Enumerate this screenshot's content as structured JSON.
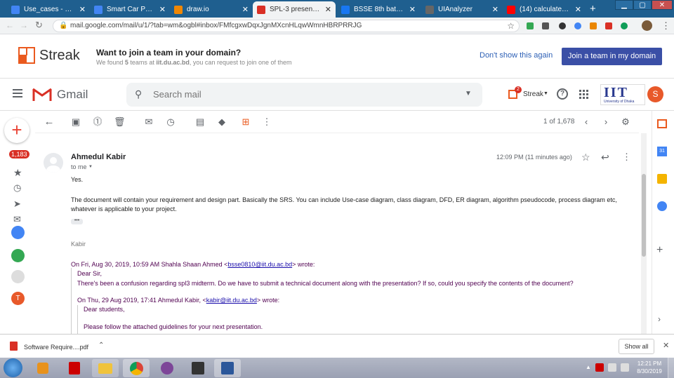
{
  "browser": {
    "tabs": [
      {
        "title": "Use_cases - Google",
        "color": "#4285f4"
      },
      {
        "title": "Smart Car Parking /",
        "color": "#4285f4"
      },
      {
        "title": "draw.io",
        "color": "#f08705"
      },
      {
        "title": "SPL-3 presentation",
        "color": "#d93025"
      },
      {
        "title": "BSSE 8th batch, IIT",
        "color": "#1877f2"
      },
      {
        "title": "UIAnalyzer",
        "color": "#333333"
      },
      {
        "title": "(14) calculate dista",
        "color": "#ff0000"
      }
    ],
    "new_tab": "+",
    "url": "mail.google.com/mail/u/1/?tab=wm&ogbl#inbox/FMfcgxwDqxJgnMXcnHLqwWmnHBRPRRJG"
  },
  "streak": {
    "brand": "Streak",
    "headline": "Want to join a team in your domain?",
    "sub_a": "We found ",
    "sub_count": "5",
    "sub_b": " teams at ",
    "sub_domain": "iit.du.ac.bd",
    "sub_c": ", you can request to join one of them",
    "dismiss": "Don't show this again",
    "join": "Join a team in my domain"
  },
  "gmail": {
    "logo": "Gmail",
    "search_placeholder": "Search mail",
    "streak_label": "Streak",
    "streak_badge": "2",
    "account_initial": "S",
    "org_logo": "IIT",
    "org_sub": "University of Dhaka",
    "inbox_count": "1,183",
    "pager": "1 of 1,678",
    "avatar_initial": "T"
  },
  "message": {
    "sender": "Ahmedul Kabir",
    "to": "to me",
    "time": "12:09 PM (11 minutes ago)",
    "body_1": "Yes.",
    "body_2": "The document will contain your requirement and design part. Basically the SRS. You can include Use-case diagram, class diagram, DFD, ER diagram, algorithm pseudocode, process diagram etc, whatever is applicable to your project.",
    "signature": "Kabir",
    "quote1_pre": "On Fri, Aug 30, 2019, 10:59 AM Shahla Shaan Ahmed <",
    "quote1_email": "bsse0810@iit.du.ac.bd",
    "quote1_post": "> wrote:",
    "quote1_l1": "Dear Sir,",
    "quote1_l2": "There's been a confusion regarding spl3 midterm.  Do we have to submit a technical document along with the presentation? If so, could you specify the contents of the document?",
    "quote2_pre": "On Thu, 29 Aug 2019, 17:41 Ahmedul Kabir, <",
    "quote2_email": "kabir@iit.du.ac.bd",
    "quote2_post": "> wrote:",
    "quote2_l1": "Dear students,",
    "quote2_l2": "Please follow the attached guidelines for your next presentation."
  },
  "downloads": {
    "file": "Software Require....pdf",
    "show_all": "Show all"
  },
  "taskbar": {
    "time": "12:21 PM",
    "date": "8/30/2019"
  }
}
